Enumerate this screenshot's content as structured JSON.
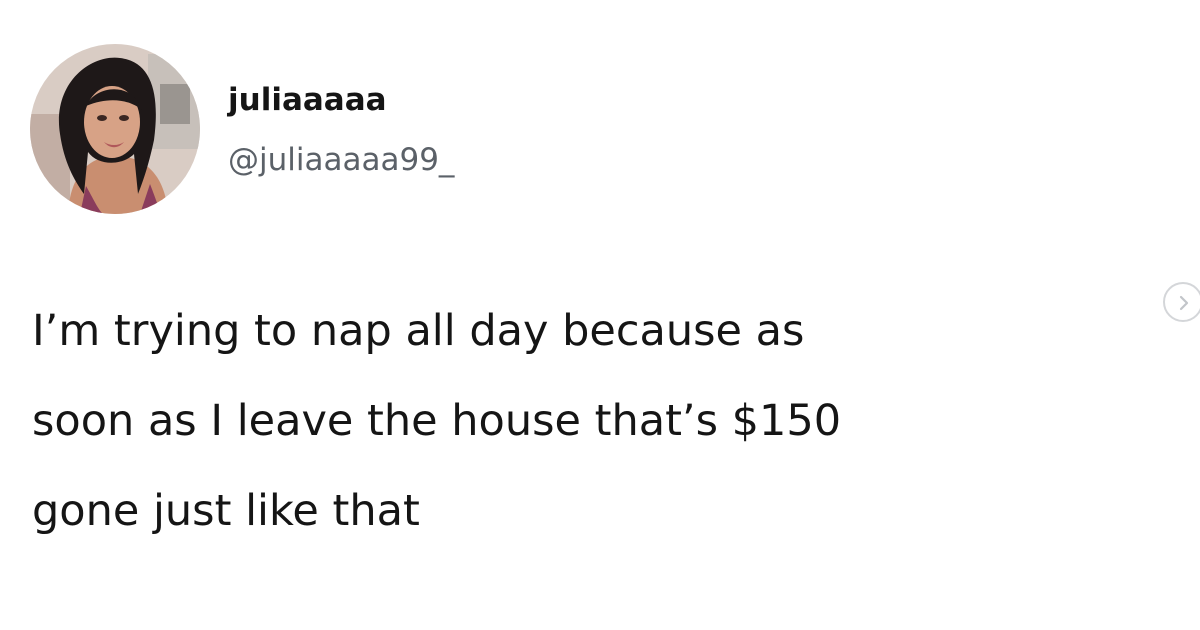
{
  "tweet": {
    "display_name": "juliaaaaa",
    "handle": "@juliaaaaa99_",
    "text_lines": [
      "I’m trying to nap all day because as",
      "soon as I leave the house that’s $150",
      "gone just like that"
    ]
  },
  "icons": {
    "avatar": "profile-photo",
    "next": "chevron-right-icon"
  },
  "colors": {
    "background": "#ffffff",
    "name": "#151515",
    "handle": "#5b6168",
    "text": "#151515",
    "control_border": "#d4d6d9"
  }
}
